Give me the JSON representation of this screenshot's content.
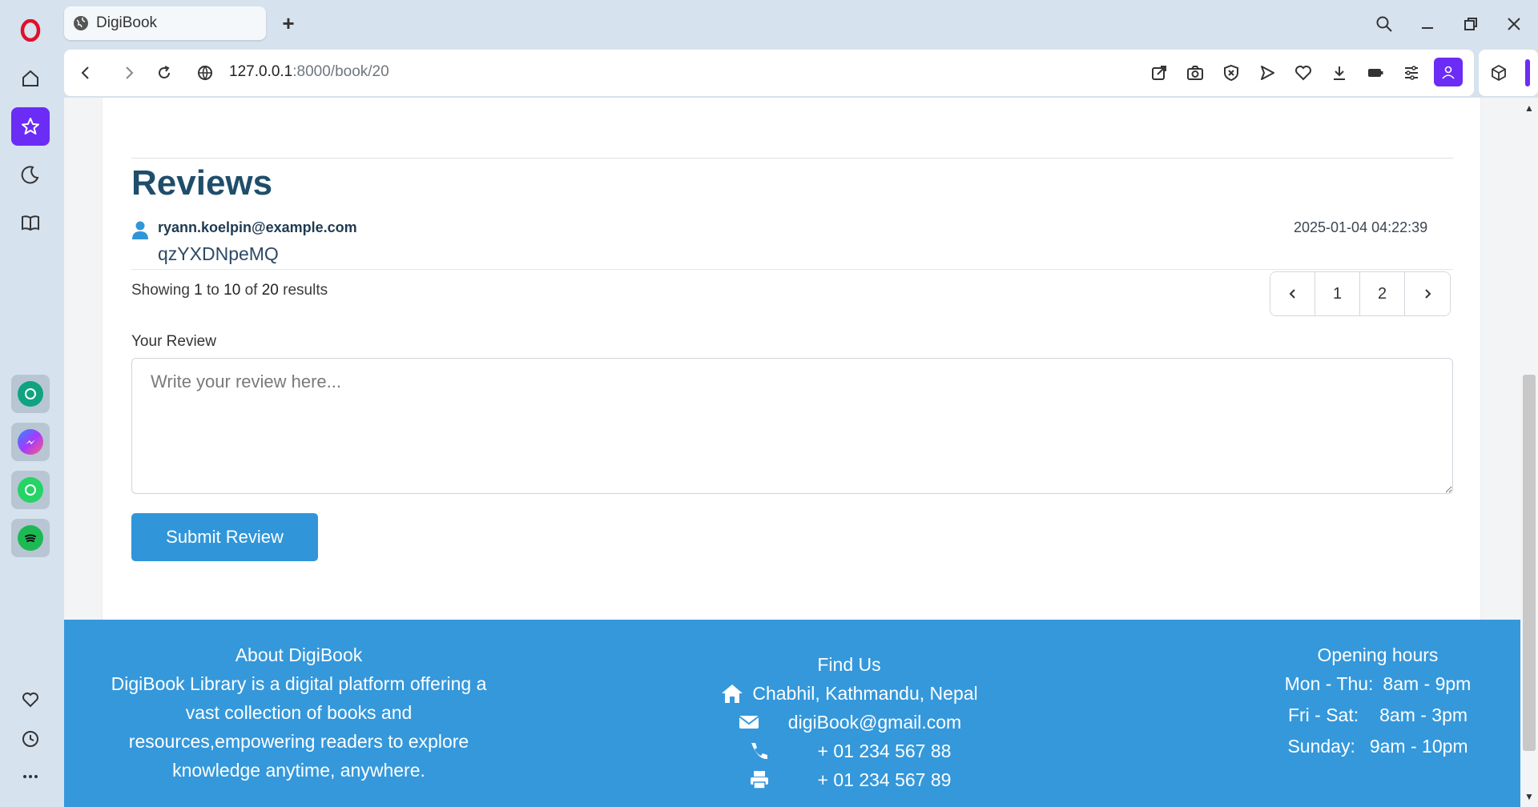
{
  "browser": {
    "tab_title": "DigiBook",
    "new_tab_label": "+",
    "url_host": "127.0.0.1",
    "url_path": ":8000/book/20"
  },
  "sidebar": {
    "items": [
      "opera-logo",
      "home",
      "pinboards",
      "dark-mode",
      "reading-list",
      "chatgpt",
      "messenger",
      "whatsapp",
      "spotify",
      "favorites",
      "history",
      "more"
    ]
  },
  "reviews": {
    "title": "Reviews",
    "items": [
      {
        "email": "ryann.koelpin@example.com",
        "date": "2025-01-04 04:22:39",
        "text": "qzYXDNpeMQ"
      }
    ],
    "results_prefix": "Showing",
    "results_from": "1",
    "results_to_word": "to",
    "results_to": "10",
    "results_of_word": "of",
    "results_total": "20",
    "results_suffix": "results",
    "pages": [
      "1",
      "2"
    ],
    "form_label": "Your Review",
    "placeholder": "Write your review here...",
    "submit_label": "Submit Review"
  },
  "footer": {
    "about_title": "About DigiBook",
    "about_text": "DigiBook Library is a digital platform offering a vast collection of books and resources,empowering readers to explore knowledge anytime, anywhere.",
    "find_title": "Find Us",
    "address": "Chabhil, Kathmandu, Nepal",
    "email": "digiBook@gmail.com",
    "phone": "+ 01 234 567 88",
    "fax": "+ 01 234 567 89",
    "hours_title": "Opening hours",
    "hours": [
      {
        "days": "Mon - Thu:",
        "time": "8am - 9pm"
      },
      {
        "days": "Fri - Sat:",
        "time": "8am - 3pm"
      },
      {
        "days": "Sunday:",
        "time": "9am - 10pm"
      }
    ]
  },
  "colors": {
    "accent": "#3498db",
    "button": "#3196d9",
    "title": "#1f4e6b",
    "opera_purple": "#6b2cf5"
  }
}
